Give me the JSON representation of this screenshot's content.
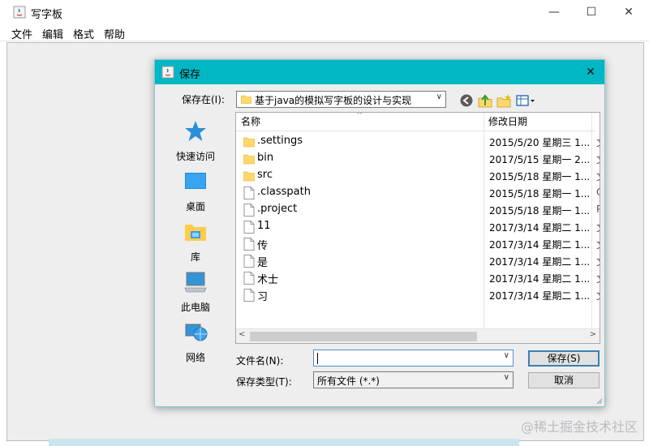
{
  "main_window": {
    "title": "写字板",
    "menu": [
      "文件",
      "编辑",
      "格式",
      "帮助"
    ],
    "controls": {
      "minimize": "—",
      "maximize": "☐",
      "close": "✕"
    }
  },
  "watermark": "@稀土掘金技术社区",
  "dialog": {
    "title": "保存",
    "close": "✕",
    "save_in_label": "保存在(I):",
    "save_in_value": "基于java的模拟写字板的设计与实现",
    "toolbar": [
      "back-icon",
      "up-folder-icon",
      "new-folder-icon",
      "view-menu-icon"
    ],
    "places": [
      {
        "label": "快速访问",
        "icon": "star-icon"
      },
      {
        "label": "桌面",
        "icon": "desktop-icon"
      },
      {
        "label": "库",
        "icon": "library-icon"
      },
      {
        "label": "此电脑",
        "icon": "computer-icon"
      },
      {
        "label": "网络",
        "icon": "network-icon"
      }
    ],
    "columns": {
      "name": "名称",
      "modified": "修改日期"
    },
    "files": [
      {
        "name": ".settings",
        "type": "folder",
        "modified": "2015/5/20 星期三 1...",
        "extra": "文"
      },
      {
        "name": "bin",
        "type": "folder",
        "modified": "2017/5/15 星期一 2...",
        "extra": "文"
      },
      {
        "name": "src",
        "type": "folder",
        "modified": "2015/5/18 星期一 1...",
        "extra": "文"
      },
      {
        "name": ".classpath",
        "type": "file",
        "modified": "2015/5/18 星期一 1...",
        "extra": "C"
      },
      {
        "name": ".project",
        "type": "file",
        "modified": "2015/5/18 星期一 1...",
        "extra": "P"
      },
      {
        "name": "11",
        "type": "file",
        "modified": "2017/3/14 星期二 1...",
        "extra": "文"
      },
      {
        "name": "传",
        "type": "file",
        "modified": "2017/3/14 星期二 1...",
        "extra": "文"
      },
      {
        "name": "是",
        "type": "file",
        "modified": "2017/3/14 星期二 1...",
        "extra": "文"
      },
      {
        "name": "术士",
        "type": "file",
        "modified": "2017/3/14 星期二 1...",
        "extra": "文"
      },
      {
        "name": "习",
        "type": "file",
        "modified": "2017/3/14 星期二 1...",
        "extra": "文"
      }
    ],
    "filename_label": "文件名(N):",
    "filename_value": "",
    "filetype_label": "保存类型(T):",
    "filetype_value": "所有文件 (*.*)",
    "save_button": "保存(S)",
    "cancel_button": "取消"
  },
  "colors": {
    "dialog_title": "#00b7c3",
    "folder": "#ffd86b",
    "accent": "#3c7fb1"
  }
}
